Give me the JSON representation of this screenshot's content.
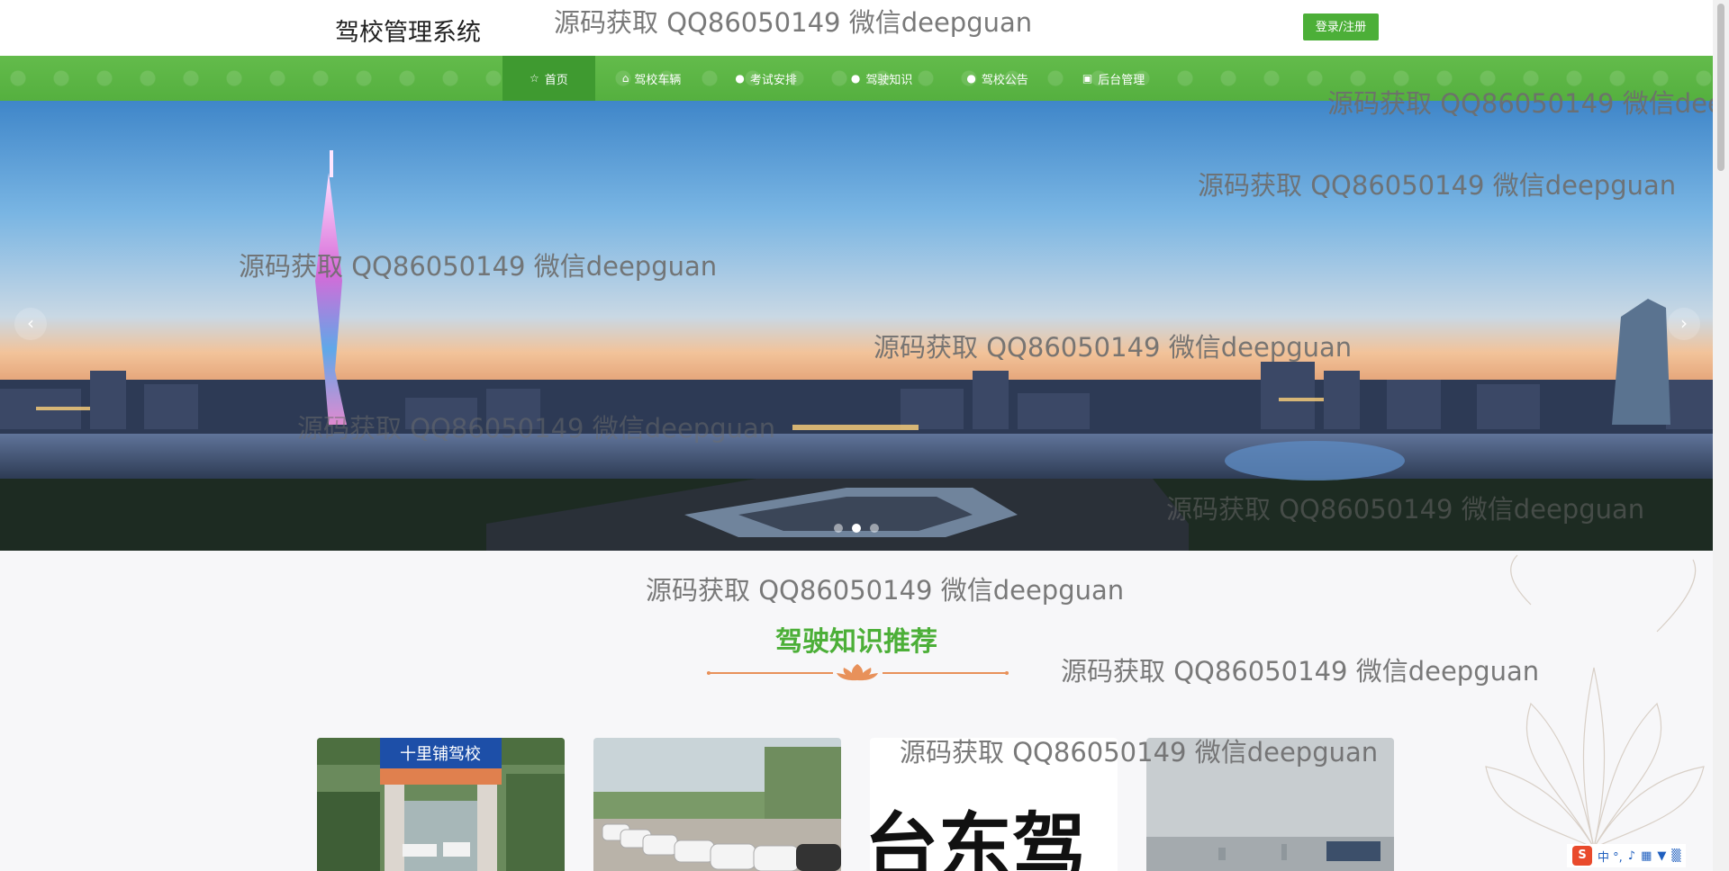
{
  "header": {
    "brand": "驾校管理系统",
    "login_label": "登录/注册"
  },
  "nav": {
    "items": [
      {
        "label": "首页",
        "icon": "☆"
      },
      {
        "label": "驾校车辆",
        "icon": "⌂"
      },
      {
        "label": "考试安排",
        "icon": "●"
      },
      {
        "label": "驾驶知识",
        "icon": "●"
      },
      {
        "label": "驾校公告",
        "icon": "●"
      },
      {
        "label": "后台管理",
        "icon": "▣"
      }
    ]
  },
  "banner": {
    "prev": "‹",
    "next": "›"
  },
  "section": {
    "title": "驾驶知识推荐"
  },
  "cards": [
    {
      "caption": "十里铺驾校"
    },
    {
      "caption": ""
    },
    {
      "caption": "台东驾"
    },
    {
      "caption": ""
    }
  ],
  "watermark": "源码获取 QQ86050149 微信deepguan",
  "ime": {
    "text": "中 °, "
  },
  "colors": {
    "accent": "#4caf38",
    "nav": "#5ab544",
    "nav_active": "#3f9a30",
    "divider": "#e8915a"
  }
}
